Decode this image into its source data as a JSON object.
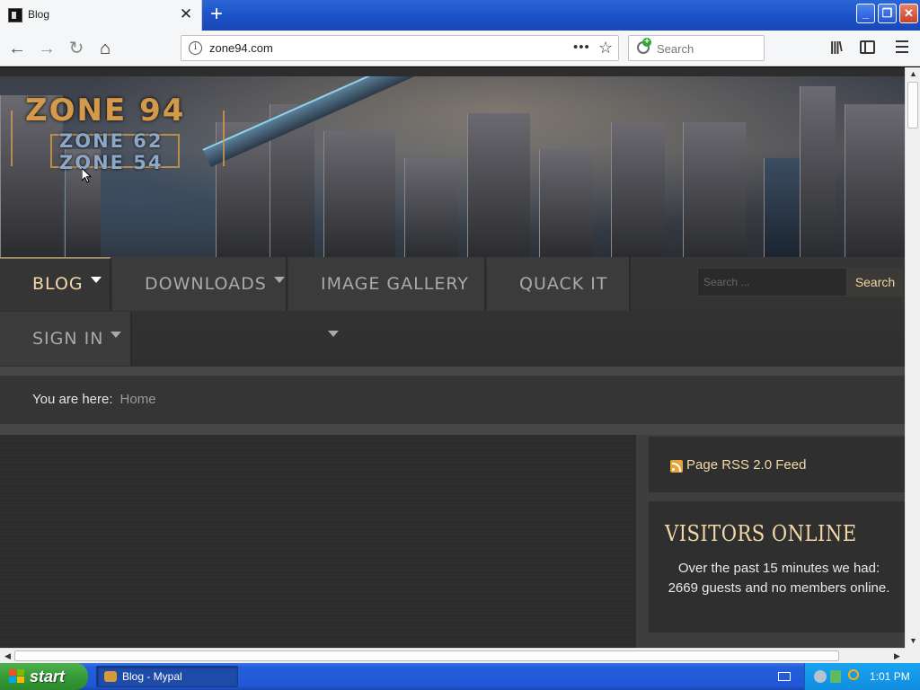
{
  "browser": {
    "tab_title": "Blog",
    "tab_close": "✕",
    "new_tab": "+",
    "url": "zone94.com",
    "url_more": "•••",
    "search_placeholder": "Search",
    "icons": [
      "back-icon",
      "forward-icon",
      "reload-icon",
      "home-icon",
      "info-icon",
      "bookmark-star-icon",
      "library-icon",
      "sidebar-icon",
      "menu-icon"
    ]
  },
  "site": {
    "logo_main": "ZONE 94",
    "logo_line2": "ZONE 62",
    "logo_line3": "ZONE 54",
    "nav": {
      "items": [
        {
          "label": "BLOG",
          "has_caret": true,
          "active": true
        },
        {
          "label": "DOWNLOADS",
          "has_caret": true
        },
        {
          "label": "IMAGE GALLERY",
          "has_caret": true
        },
        {
          "label": "QUACK IT",
          "has_caret": false
        },
        {
          "label": "SIGN IN",
          "has_caret": true
        }
      ],
      "search_placeholder": "Search ...",
      "search_button": "Search"
    },
    "breadcrumb": {
      "prefix": "You are here:",
      "home": "Home"
    },
    "sidebar": {
      "rss_label": "Page RSS 2.0 Feed",
      "visitors_title": "VISITORS ONLINE",
      "visitors_text": "Over the past 15 minutes we had: 2669 guests and no members online."
    }
  },
  "taskbar": {
    "start_label": "start",
    "task_item": "Blog - Mypal",
    "clock": "1:01 PM"
  },
  "colors": {
    "accent_gold": "#f4d8a5",
    "nav_text": "#a9a9a9",
    "xp_blue": "#245edb",
    "start_green": "#379a37"
  }
}
